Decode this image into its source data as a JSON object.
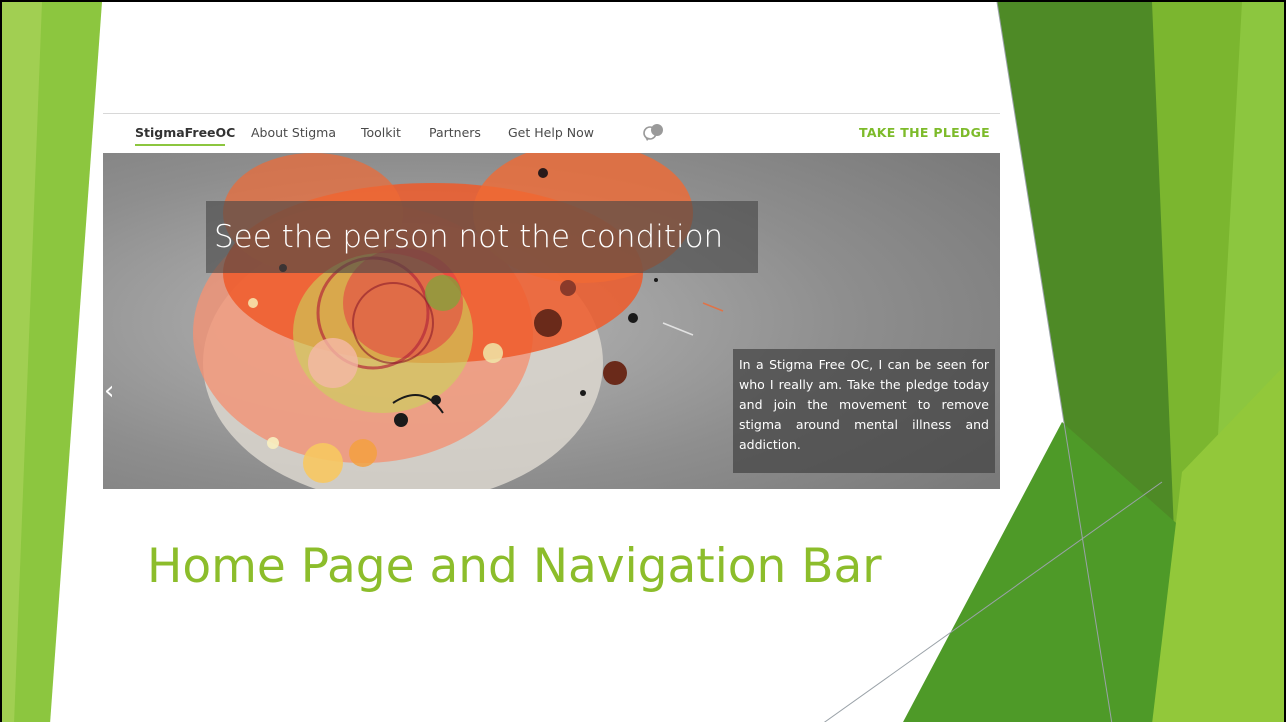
{
  "slide_title": "Home Page and Navigation Bar",
  "nav": {
    "items": [
      {
        "label": "StigmaFreeOC",
        "active": true
      },
      {
        "label": "About Stigma"
      },
      {
        "label": "Toolkit"
      },
      {
        "label": "Partners"
      },
      {
        "label": "Get Help Now"
      }
    ],
    "language_icon": "speech-bubbles-icon",
    "cta": "TAKE THE PLEDGE"
  },
  "hero": {
    "headline": "See the person not the condition",
    "caption": "In a Stigma Free OC, I can be seen for who I really am. Take the pledge today and join the movement to remove stigma around mental illness and addiction.",
    "prev_arrow": "‹"
  },
  "colors": {
    "accent_green": "#8cbd2b",
    "nav_green": "#7dbb2a",
    "dark_green": "#4e8a26"
  }
}
